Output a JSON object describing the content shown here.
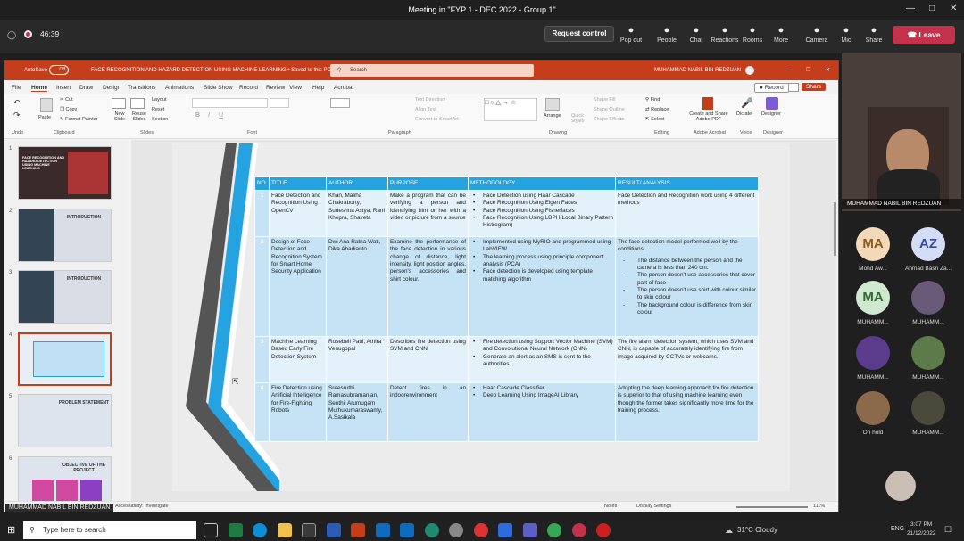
{
  "teams": {
    "window_title": "Meeting in \"FYP 1 - DEC 2022 - Group 1\"",
    "timer": "46:39",
    "request_control": "Request control",
    "toolbar": [
      {
        "icon": "pop-out-icon",
        "label": "Pop out"
      },
      {
        "icon": "people-icon",
        "label": "People"
      },
      {
        "icon": "chat-icon",
        "label": "Chat"
      },
      {
        "icon": "reactions-icon",
        "label": "Reactions"
      },
      {
        "icon": "rooms-icon",
        "label": "Rooms"
      },
      {
        "icon": "more-icon",
        "label": "More"
      },
      {
        "icon": "camera-icon",
        "label": "Camera"
      },
      {
        "icon": "mic-icon",
        "label": "Mic"
      },
      {
        "icon": "share-icon",
        "label": "Share"
      }
    ],
    "leave": "Leave",
    "presenter_label": "MUHAMMAD NABIL BIN REDZUAN",
    "speaker_name": "MUHAMMAD NABIL BIN REDZUAN",
    "participants": [
      {
        "initials": "MA",
        "name": "Mohd Aw...",
        "color": "#f3d9b8",
        "text": "#8a5a1c"
      },
      {
        "initials": "AZ",
        "name": "Ahmad Basri Za...",
        "color": "#d4ddf6",
        "text": "#364a9c"
      },
      {
        "initials": "MA",
        "name": "MUHAMM...",
        "color": "#cfe8cf",
        "text": "#2e6b2e"
      },
      {
        "initials": "",
        "name": "MUHAMM...",
        "color": "#6a5a7a",
        "text": "#fff"
      },
      {
        "initials": "",
        "name": "MUHAMM...",
        "color": "#5b3b8c",
        "text": "#fff"
      },
      {
        "initials": "",
        "name": "MUHAMM...",
        "color": "#5d7a4a",
        "text": "#fff"
      },
      {
        "initials": "",
        "name": "On hold",
        "color": "#8a6a4a",
        "text": "#fff"
      },
      {
        "initials": "",
        "name": "MUHAMM...",
        "color": "#4a4a3a",
        "text": "#fff"
      }
    ]
  },
  "ppt": {
    "autosave": "AutoSave",
    "autosave_state": "Off",
    "doc_title": "FACE RECOGNITION AND HAZARD DETECTION USING MACHINE LEARNING • Saved to this PC",
    "search_placeholder": "Search",
    "user": "MUHAMMAD NABIL BIN REDZUAN",
    "menu": [
      "File",
      "Home",
      "Insert",
      "Draw",
      "Design",
      "Transitions",
      "Animations",
      "Slide Show",
      "Record",
      "Review",
      "View",
      "Help",
      "Acrobat"
    ],
    "record_btn": "Record",
    "share_btn": "Share",
    "groups": [
      "Undo",
      "Clipboard",
      "Slides",
      "Font",
      "Paragraph",
      "Drawing",
      "Editing",
      "Adobe Acrobat",
      "Voice",
      "Designer"
    ],
    "ribbon": {
      "paste": "Paste",
      "cut": "Cut",
      "copy": "Copy",
      "format_painter": "Format Painter",
      "new_slide": "New Slide",
      "reuse_slides": "Reuse Slides",
      "layout": "Layout",
      "reset": "Reset",
      "section": "Section",
      "text_direction": "Text Direction",
      "align_text": "Align Text",
      "convert_smartart": "Convert to SmartArt",
      "arrange": "Arrange",
      "quick_styles": "Quick Styles",
      "shape_fill": "Shape Fill",
      "shape_outline": "Shape Outline",
      "shape_effects": "Shape Effects",
      "find": "Find",
      "replace": "Replace",
      "select": "Select",
      "create_share": "Create and Share Adobe PDF",
      "dictate": "Dictate",
      "designer": "Designer"
    },
    "thumbnails": [
      {
        "num": "1",
        "title": "FACE RECOGNITION AND HAZARD DETECTION USING MACHINE LEARNING"
      },
      {
        "num": "2",
        "title": "INTRODUCTION"
      },
      {
        "num": "3",
        "title": "INTRODUCTION"
      },
      {
        "num": "4",
        "title": ""
      },
      {
        "num": "5",
        "title": "PROBLEM STATEMENT"
      },
      {
        "num": "6",
        "title": "OBJECTIVE OF THE PROJECT"
      }
    ],
    "status": {
      "accessibility": "Accessibility: Investigate",
      "notes": "Notes",
      "display": "Display Settings",
      "zoom": "111%"
    }
  },
  "slide_table": {
    "headers": [
      "NO",
      "TITLE",
      "AUTHOR",
      "PURPOSE",
      "METHODOLOGY",
      "RESULT/ ANALYSIS"
    ],
    "rows": [
      {
        "no": "1",
        "title": "Face Detection and Recognition Using OpenCV",
        "author": "Khan, Maliha Chakraborty, Sudeshna Astya, Rani Khepra, Shaveta",
        "purpose": "Make a program that can be verifying a person and identifying him or her with a video or picture from a source",
        "methodology": [
          "Face Detection using Haar Cascade",
          "Face Recognition Using Eigen Faces",
          "Face Recognition Using Fisherfaces",
          "Face Recognition Using LBPH(Local Binary Pattern Histrogram)"
        ],
        "result": "Face Detection and Recognition work using 4 different methods",
        "result_list": []
      },
      {
        "no": "2",
        "title": "Design of Face Detection and Recognition System for Smart Home Security Application",
        "author": "Dwi Ana Ratna Wati, Dika Abadianto",
        "purpose": "Examine the performance of the face detection in various change of distance, light intensity, light position angles, person's accessories and shirt colour.",
        "methodology": [
          "Implemented using MyRIO and programmed using LabVIEW",
          "The learning process using principle component analysis (PCA)",
          "Face detection is developed using template matching algorithm"
        ],
        "result": "The face detection model performed well by the conditions:",
        "result_list": [
          "The distance between the person and the camera is less than 240 cm.",
          "The person doesn't use accessories that cover part of face",
          "The person doesn't use shirt with colour similar to skin colour",
          "The background colour is difference from skin colour"
        ]
      },
      {
        "no": "3",
        "title": "Machine Learning Based Early Fire Detection System",
        "author": "Rosebell Paul, Athira Venugopal",
        "purpose": "Describes fire detection using SVM and CNN",
        "methodology": [
          "Fire detection using Support Vector Machine (SVM) and Convolutional Neural Network (CNN)",
          "Generate an alert as an SMS is sent to the authorities."
        ],
        "result": "The fire alarm detection system, which uses SVM and CNN, is capable of accurately identifying fire from image acquired by CCTVs or webcams.",
        "result_list": []
      },
      {
        "no": "4",
        "title": "Fire Detection using Artificial Intelligence for Fire-Fighting Robots",
        "author": "Sreesruthi Ramasubramanian, Senthil Arumugam Muthukumaraswamy, A.Sasikala",
        "purpose": "Detect fires in an indoorenvironment",
        "methodology": [
          "Haar Cascade Classifier",
          "Deep Learning Using ImageAI Library"
        ],
        "result": "Adopting the deep learning approach for fire detection is superior to that of using machine learning even though the former takes significantly more time for the training process.",
        "result_list": []
      }
    ]
  },
  "taskbar": {
    "search": "Type here to search",
    "weather": "31°C Cloudy",
    "lang": "ENG",
    "time": "3:07 PM",
    "date": "21/12/2022"
  }
}
